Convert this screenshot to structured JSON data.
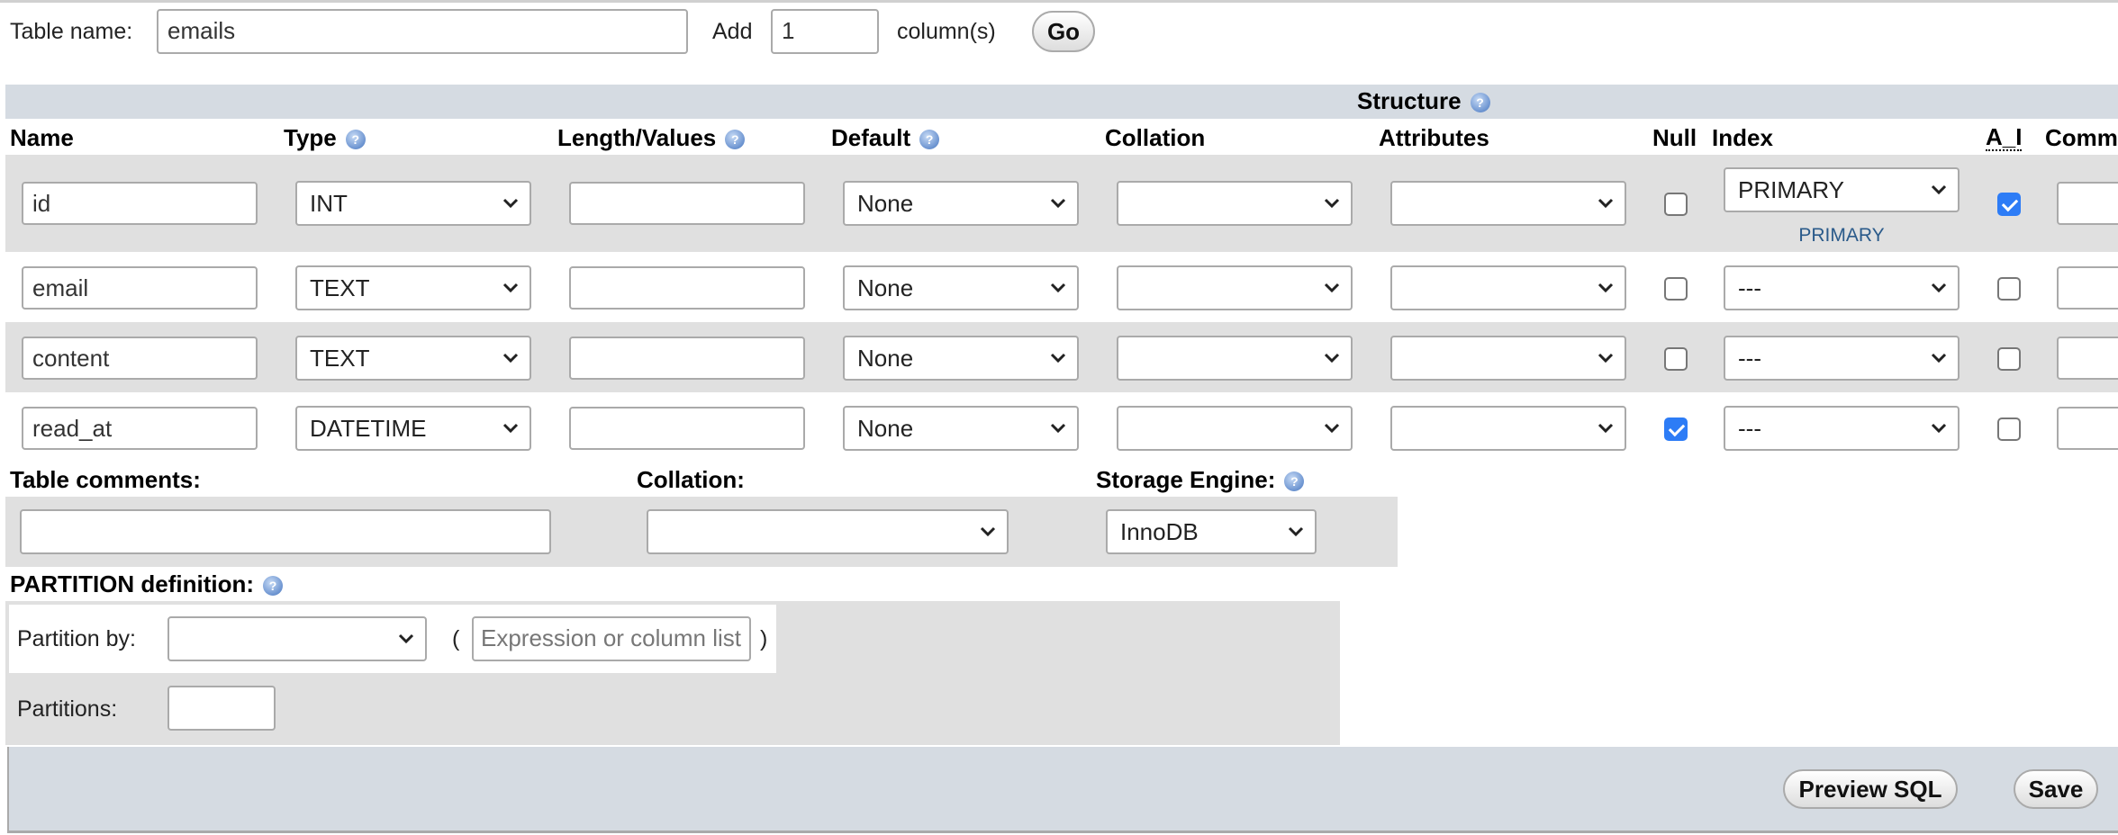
{
  "top": {
    "table_name_label": "Table name:",
    "table_name_value": "emails",
    "add_label": "Add",
    "add_count": "1",
    "columns_label": "column(s)",
    "go_label": "Go"
  },
  "structure": {
    "title": "Structure",
    "headers": {
      "name": "Name",
      "type": "Type",
      "length": "Length/Values",
      "default": "Default",
      "collation": "Collation",
      "attributes": "Attributes",
      "null": "Null",
      "index": "Index",
      "ai": "A_I",
      "comments": "Comm"
    },
    "rows": [
      {
        "name": "id",
        "type": "INT",
        "length": "",
        "default": "None",
        "collation": "",
        "attributes": "",
        "null": false,
        "index": "PRIMARY",
        "index_note": "PRIMARY",
        "ai": true
      },
      {
        "name": "email",
        "type": "TEXT",
        "length": "",
        "default": "None",
        "collation": "",
        "attributes": "",
        "null": false,
        "index": "---",
        "ai": false
      },
      {
        "name": "content",
        "type": "TEXT",
        "length": "",
        "default": "None",
        "collation": "",
        "attributes": "",
        "null": false,
        "index": "---",
        "ai": false
      },
      {
        "name": "read_at",
        "type": "DATETIME",
        "length": "",
        "default": "None",
        "collation": "",
        "attributes": "",
        "null": true,
        "index": "---",
        "ai": false
      }
    ]
  },
  "table_options": {
    "comments_label": "Table comments:",
    "comments_value": "",
    "collation_label": "Collation:",
    "collation_value": "",
    "engine_label": "Storage Engine:",
    "engine_value": "InnoDB"
  },
  "partition": {
    "title": "PARTITION definition:",
    "by_label": "Partition by:",
    "by_value": "",
    "open_paren": "(",
    "expression_placeholder": "Expression or column list",
    "close_paren": ")",
    "partitions_label": "Partitions:",
    "partitions_value": ""
  },
  "footer": {
    "preview_sql": "Preview SQL",
    "save": "Save"
  },
  "colors": {
    "band": "#d5dbe2",
    "row_alt": "#e0e0e0",
    "checkbox_checked": "#2d7cf6",
    "index_note": "#2a5a8a"
  }
}
